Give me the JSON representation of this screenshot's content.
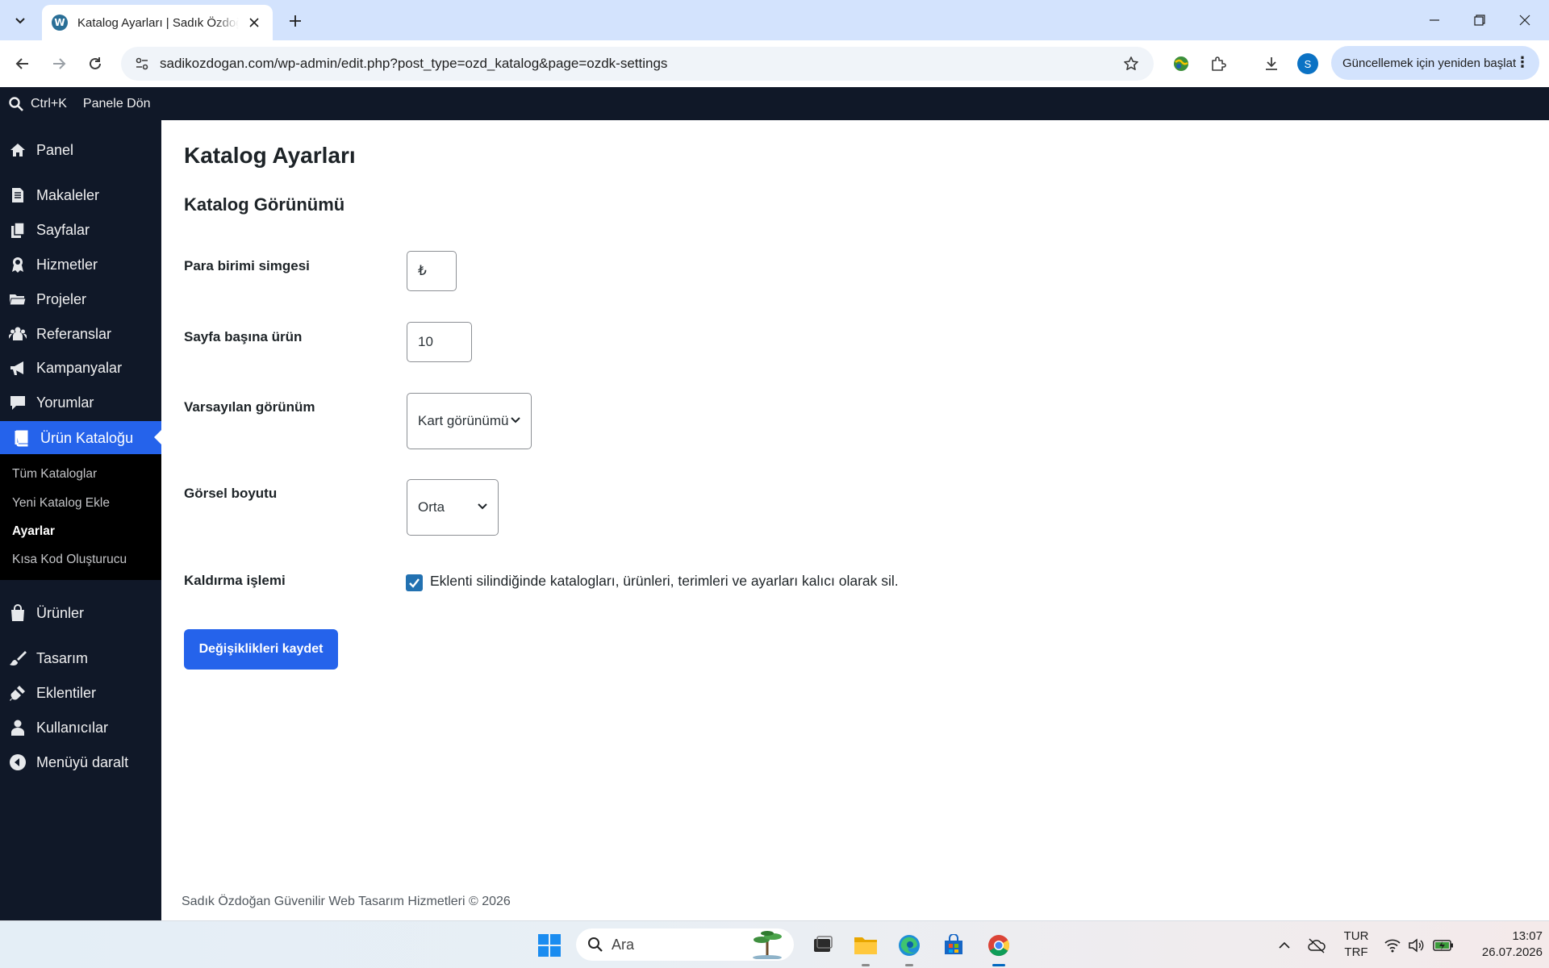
{
  "browser": {
    "tab_title": "Katalog Ayarları | Sadık Özdoğan Güvenilir Web Tasarım Hizmetleri",
    "favicon_letter": "W",
    "url": "sadikozdogan.com/wp-admin/edit.php?post_type=ozd_katalog&page=ozdk-settings",
    "profile_letter": "S",
    "update_label": "Güncellemek için yeniden başlat"
  },
  "adminbar": {
    "search_shortcut": "Ctrl+K",
    "back_label": "Panele Dön"
  },
  "sidebar": {
    "items": [
      {
        "label": "Panel",
        "icon": "home-icon"
      },
      {
        "label": "Makaleler",
        "icon": "document-icon"
      },
      {
        "label": "Sayfalar",
        "icon": "pages-icon"
      },
      {
        "label": "Hizmetler",
        "icon": "award-icon"
      },
      {
        "label": "Projeler",
        "icon": "folder-icon"
      },
      {
        "label": "Referanslar",
        "icon": "groups-icon"
      },
      {
        "label": "Kampanyalar",
        "icon": "megaphone-icon"
      },
      {
        "label": "Yorumlar",
        "icon": "comment-icon"
      },
      {
        "label": "Ürün Kataloğu",
        "icon": "book-icon"
      },
      {
        "label": "Ürünler",
        "icon": "shopping-bag-icon"
      },
      {
        "label": "Tasarım",
        "icon": "paintbrush-icon"
      },
      {
        "label": "Eklentiler",
        "icon": "plugin-icon"
      },
      {
        "label": "Kullanıcılar",
        "icon": "user-icon"
      },
      {
        "label": "Menüyü daralt",
        "icon": "collapse-icon"
      }
    ],
    "submenu": [
      {
        "label": "Tüm Kataloglar"
      },
      {
        "label": "Yeni Katalog Ekle"
      },
      {
        "label": "Ayarlar"
      },
      {
        "label": "Kısa Kod Oluşturucu"
      }
    ]
  },
  "content": {
    "page_title": "Katalog Ayarları",
    "section_title": "Katalog Görünümü",
    "fields": {
      "currency_label": "Para birimi simgesi",
      "currency_value": "₺",
      "per_page_label": "Sayfa başına ürün",
      "per_page_value": "10",
      "default_view_label": "Varsayılan görünüm",
      "default_view_value": "Kart görünümü",
      "image_size_label": "Görsel boyutu",
      "image_size_value": "Orta",
      "uninstall_label": "Kaldırma işlemi",
      "uninstall_checkbox_label": "Eklenti silindiğinde katalogları, ürünleri, terimleri ve ayarları kalıcı olarak sil.",
      "uninstall_checked": true
    },
    "save_button": "Değişiklikleri kaydet",
    "footer": "Sadık Özdoğan Güvenilir Web Tasarım Hizmetleri © 2026"
  },
  "taskbar": {
    "search_placeholder": "Ara",
    "lang_top": "TUR",
    "lang_bottom": "TRF",
    "time": "13:07",
    "date": "26.07.2026"
  },
  "colors": {
    "accent": "#2563eb",
    "admin_dark": "#101828",
    "checkbox": "#2271b1"
  }
}
